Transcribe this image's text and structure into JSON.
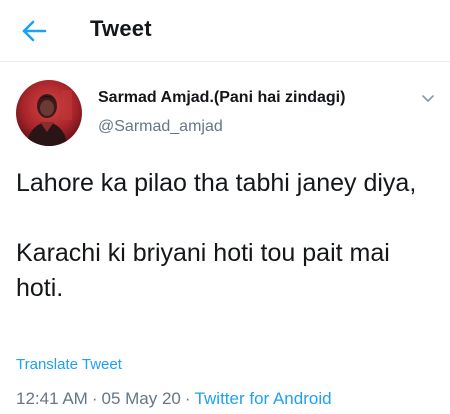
{
  "header": {
    "title": "Tweet",
    "back_icon": "arrow-left-icon",
    "accent_color": "#1da1f2"
  },
  "tweet": {
    "author": {
      "display_name": "Sarmad Amjad.(Pani hai zindagi)",
      "handle": "@Sarmad_amjad",
      "avatar_icon": "profile-avatar"
    },
    "menu_icon": "chevron-down-icon",
    "text": "Lahore ka pilao tha tabhi janey diya,\n\nKarachi ki briyani hoti tou pait mai hoti.",
    "translate_label": "Translate Tweet",
    "time": "12:41 AM",
    "separator": "·",
    "date": "05 May 20",
    "source": "Twitter for Android"
  }
}
